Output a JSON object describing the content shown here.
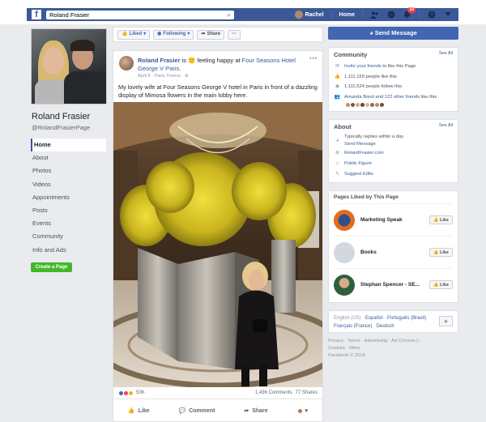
{
  "topnav": {
    "logo": "f",
    "search_value": "Roland Frasier",
    "user": "Rachel",
    "home": "Home",
    "notif_count": "10"
  },
  "profile": {
    "name": "Roland Frasier",
    "handle": "@RolandFrasierPage",
    "nav": [
      "Home",
      "About",
      "Photos",
      "Videos",
      "Appointments",
      "Posts",
      "Events",
      "Community",
      "Info and Ads"
    ],
    "create_page": "Create a Page"
  },
  "actionbar": {
    "liked": "Liked",
    "following": "Following",
    "share": "Share",
    "more": "···"
  },
  "post": {
    "author": "Roland Frasier",
    "is": "is",
    "feeling": "feeling happy at",
    "place": "Four Seasons Hotel George V Paris",
    "date": "April 8 · Paris, France ·",
    "text": "My lovely wife at Four Seasons George V hotel in Paris in front of a dazzling display of Mimosa flowers in the main lobby here.",
    "reactions": "50K",
    "comments": "1,436 Comments",
    "shares": "77 Shares",
    "like": "Like",
    "comment": "Comment",
    "share": "Share"
  },
  "sidebar": {
    "send_message": "Send Message",
    "community": {
      "title": "Community",
      "see_all": "See All",
      "invite": "Invite your friends",
      "invite_rest": "to like this Page",
      "likes": "1,111,159 people like this",
      "follows": "1,111,524 people follow this",
      "friends_a": "Amanda Bond",
      "friends_b": "and",
      "friends_c": "122 other friends",
      "friends_d": "like this"
    },
    "about": {
      "title": "About",
      "see_all": "See All",
      "replies": "Typically replies within a day",
      "send": "Send Message",
      "site": "RolandFrasier.com",
      "figure": "Public Figure",
      "suggest": "Suggest Edits"
    },
    "pages": {
      "title": "Pages Liked by This Page",
      "items": [
        {
          "name": "Marketing Speak",
          "like": "Like"
        },
        {
          "name": "Books",
          "like": "Like"
        },
        {
          "name": "Stephan Spencer - SE...",
          "like": "Like"
        }
      ]
    },
    "languages": {
      "current": "English (US) ·",
      "l1": "Español",
      "l2": "Português (Brasil)",
      "l3": "Français (France)",
      "l4": "Deutsch"
    },
    "footer": {
      "line1": "Privacy · Terms · Advertising · Ad Choices ▷",
      "line2": "Cookies · More ·",
      "line3": "Facebook © 2018"
    }
  }
}
